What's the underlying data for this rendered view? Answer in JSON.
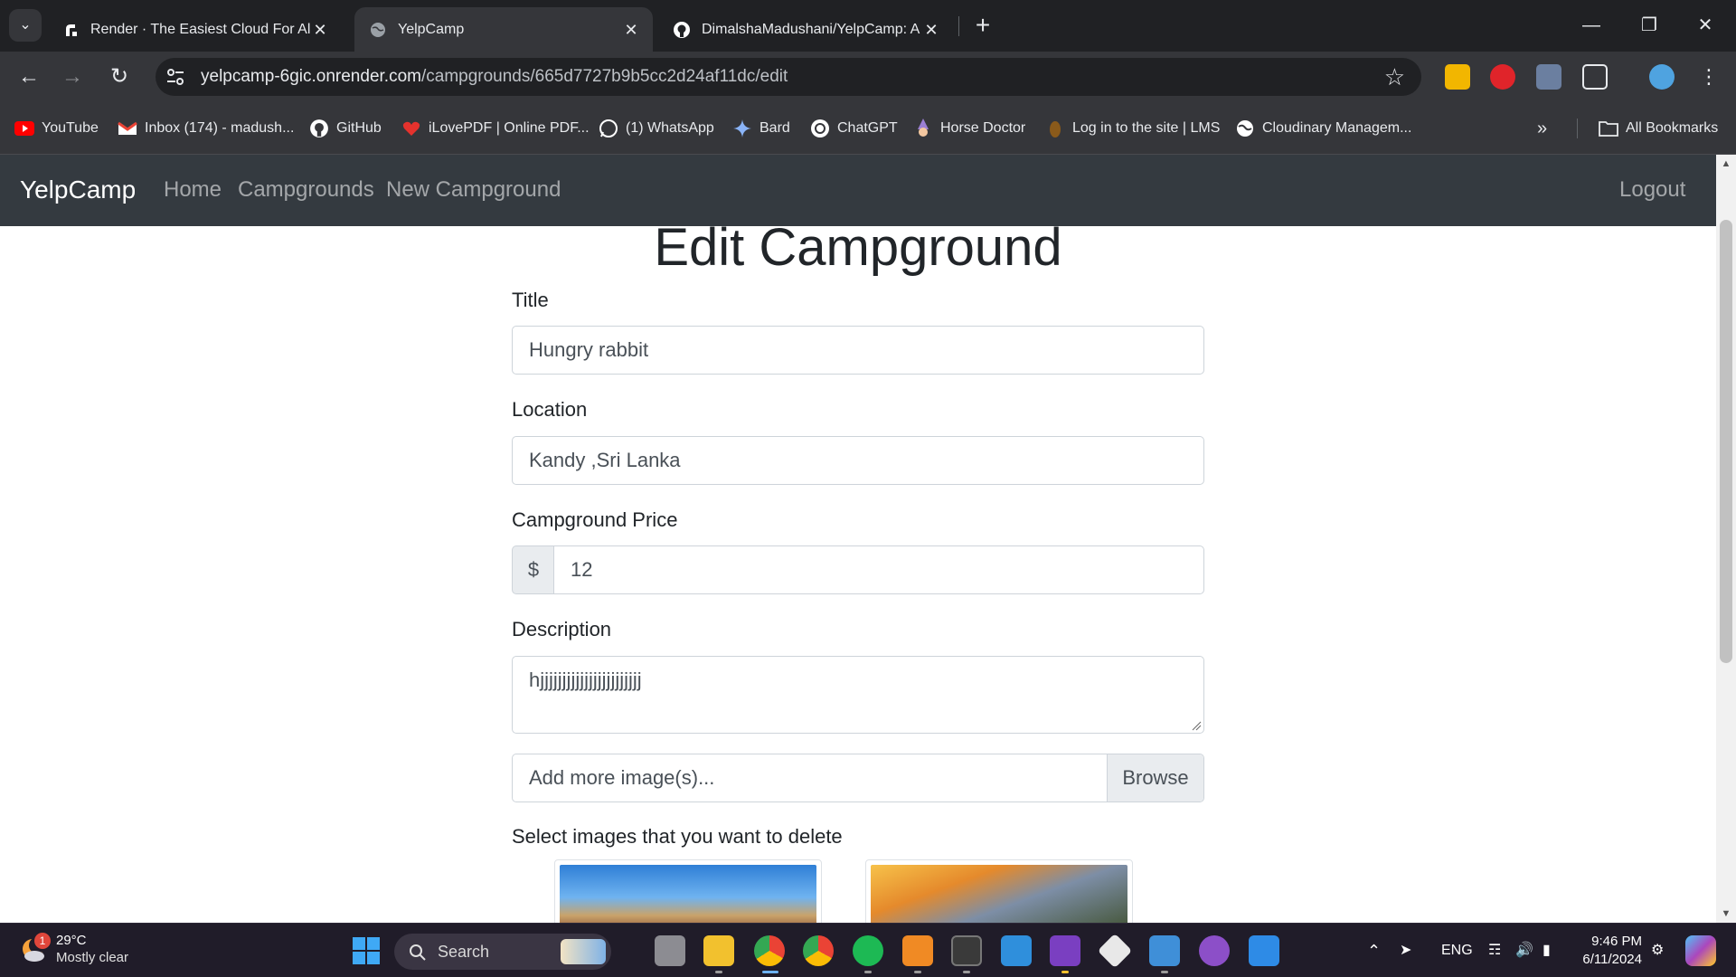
{
  "browser": {
    "tabs": [
      {
        "label": "Render · The Easiest Cloud For All Y",
        "active": false
      },
      {
        "label": "YelpCamp",
        "active": true
      },
      {
        "label": "DimalshaMadushani/YelpCamp: A",
        "active": false
      }
    ],
    "url_host": "yelpcamp-6gic.onrender.com",
    "url_path": "/campgrounds/665d7727b9b5cc2d24af11dc/edit",
    "bookmarks": [
      "YouTube",
      "Inbox (174) - madush...",
      "GitHub",
      "iLovePDF | Online PDF...",
      "(1) WhatsApp",
      "Bard",
      "ChatGPT",
      "Horse Doctor",
      "Log in to the site | LMS",
      "Cloudinary Managem..."
    ],
    "all_bookmarks": "All Bookmarks"
  },
  "site": {
    "brand": "YelpCamp",
    "nav": [
      "Home",
      "Campgrounds",
      "New Campground"
    ],
    "logout": "Logout"
  },
  "form": {
    "heading": "Edit Campground",
    "title_label": "Title",
    "title_value": "Hungry rabbit",
    "location_label": "Location",
    "location_value": "Kandy ,Sri Lanka",
    "price_label": "Campground Price",
    "price_prefix": "$",
    "price_value": "12",
    "description_label": "Description",
    "description_value": "hjjjjjjjjjjjjjjjjjjjjjjj",
    "file_placeholder": "Add more image(s)...",
    "browse_label": "Browse",
    "delete_images_label": "Select images that you want to delete"
  },
  "taskbar": {
    "weather_badge": "1",
    "temperature": "29°C",
    "condition": "Mostly clear",
    "search_label": "Search",
    "lang": "ENG",
    "time": "9:46 PM",
    "date": "6/11/2024"
  },
  "colors": {
    "navbar": "#343a40",
    "chrome_dark": "#202124",
    "chrome_toolbar": "#35363a",
    "taskbar": "#201c29"
  }
}
